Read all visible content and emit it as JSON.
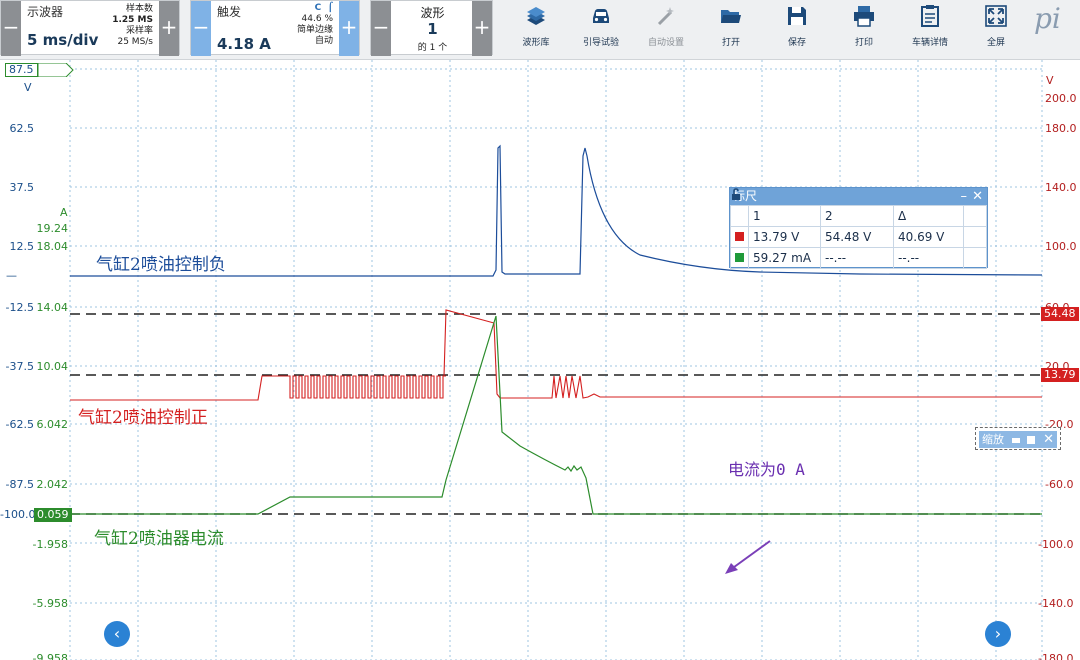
{
  "toolbar": {
    "scope": {
      "title": "示波器",
      "value": "5 ms/div",
      "samples_label": "样本数",
      "samples_value": "1.25 MS",
      "rate_label": "采样率",
      "rate_value": "25 MS/s"
    },
    "trigger": {
      "title": "触发",
      "value": "4.18 A",
      "channel": "C",
      "percent": "44.6 %",
      "mode_1": "简单边缘",
      "mode_2": "自动"
    },
    "waveform": {
      "title": "波形",
      "value": "1",
      "of": "的 1 个"
    },
    "buttons": [
      {
        "label": "波形库",
        "icon": "library-icon",
        "enabled": true
      },
      {
        "label": "引导试验",
        "icon": "car-icon",
        "enabled": true
      },
      {
        "label": "自动设置",
        "icon": "wand-icon",
        "enabled": false
      },
      {
        "label": "打开",
        "icon": "folder-icon",
        "enabled": true
      },
      {
        "label": "保存",
        "icon": "save-icon",
        "enabled": true
      },
      {
        "label": "打印",
        "icon": "printer-icon",
        "enabled": true
      },
      {
        "label": "车辆详情",
        "icon": "clipboard-icon",
        "enabled": true
      },
      {
        "label": "全屏",
        "icon": "fullscreen-icon",
        "enabled": true
      }
    ],
    "brand": "pi"
  },
  "axes": {
    "left_blue": {
      "flag": "87.5",
      "unit": "V",
      "ticks": [
        "62.5",
        "37.5",
        "12.5",
        "—",
        "-12.5",
        "-37.5",
        "-62.5",
        "-87.5",
        "-100.0"
      ]
    },
    "left_green": {
      "unit": "A",
      "ticks": [
        "19.24",
        "18.04",
        "14.04",
        "10.04",
        "6.042",
        "2.042",
        "0.059",
        "-1.958",
        "-5.958",
        "-9.958"
      ]
    },
    "right_red": {
      "unit": "V",
      "ticks": [
        "200.0",
        "180.0",
        "140.0",
        "100.0",
        "60.0",
        "20.0",
        "-20.0",
        "-60.0",
        "-100.0",
        "-140.0",
        "-180.0"
      ]
    }
  },
  "channel_labels": {
    "blue": "气缸2喷油控制负",
    "red": "气缸2喷油控制正",
    "green": "气缸2喷油器电流"
  },
  "annotation": "电流为0 A",
  "ruler": {
    "title": "标尺",
    "headers": [
      "1",
      "2",
      "Δ"
    ],
    "rows": [
      {
        "color": "#d42020",
        "v1": "13.79 V",
        "v2": "54.48 V",
        "delta": "40.69 V"
      },
      {
        "color": "#1f9a3a",
        "v1": "59.27 mA",
        "v2": "--.--",
        "delta": "--.--"
      }
    ]
  },
  "ruler_flags": {
    "upper": "54.48",
    "lower": "13.79"
  },
  "zoom_panel": {
    "label": "缩放"
  },
  "colors": {
    "blue": "#1c4d9a",
    "red": "#d42020",
    "green": "#2c8c2c",
    "accent": "#2b82d4"
  }
}
